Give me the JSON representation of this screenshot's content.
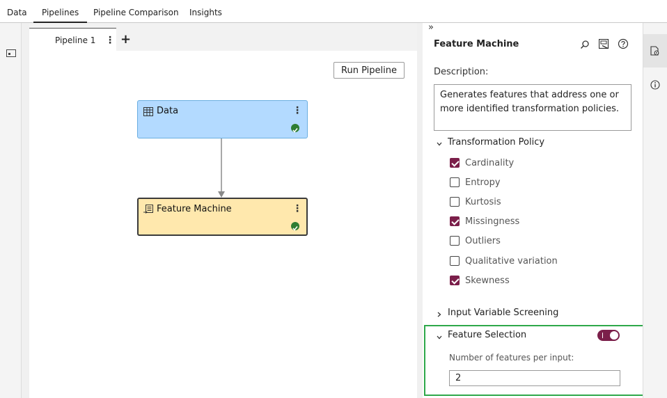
{
  "top_tabs": [
    {
      "label": "Data"
    },
    {
      "label": "Pipelines"
    },
    {
      "label": "Pipeline Comparison"
    },
    {
      "label": "Insights"
    }
  ],
  "active_top_tab": "Pipelines",
  "pipeline_tab": {
    "label": "Pipeline 1",
    "more": "⋮",
    "add": "+"
  },
  "canvas": {
    "run_button": "Run Pipeline",
    "nodes": [
      {
        "label": "Data",
        "more": "⋮",
        "status": "complete"
      },
      {
        "label": "Feature Machine",
        "more": "⋮",
        "status": "complete"
      }
    ]
  },
  "panel": {
    "collapse": "»",
    "title": "Feature Machine",
    "description_label": "Description:",
    "description": "Generates features that address one or more identified transformation policies.",
    "transformation_policy": {
      "label": "Transformation Policy",
      "expanded": true,
      "options": [
        {
          "label": "Cardinality",
          "checked": true
        },
        {
          "label": "Entropy",
          "checked": false
        },
        {
          "label": "Kurtosis",
          "checked": false
        },
        {
          "label": "Missingness",
          "checked": true
        },
        {
          "label": "Outliers",
          "checked": false
        },
        {
          "label": "Qualitative variation",
          "checked": false
        },
        {
          "label": "Skewness",
          "checked": true
        }
      ]
    },
    "input_variable_screening": {
      "label": "Input Variable Screening",
      "expanded": false
    },
    "feature_selection": {
      "label": "Feature Selection",
      "expanded": true,
      "enabled": true,
      "features_label": "Number of features per input:",
      "features_value": "2"
    }
  },
  "colors": {
    "accent": "#7b1f4a",
    "data_node": "#b3daff",
    "feature_node": "#ffe8ad",
    "highlight": "#2ea84a",
    "success": "#2e7d32"
  }
}
